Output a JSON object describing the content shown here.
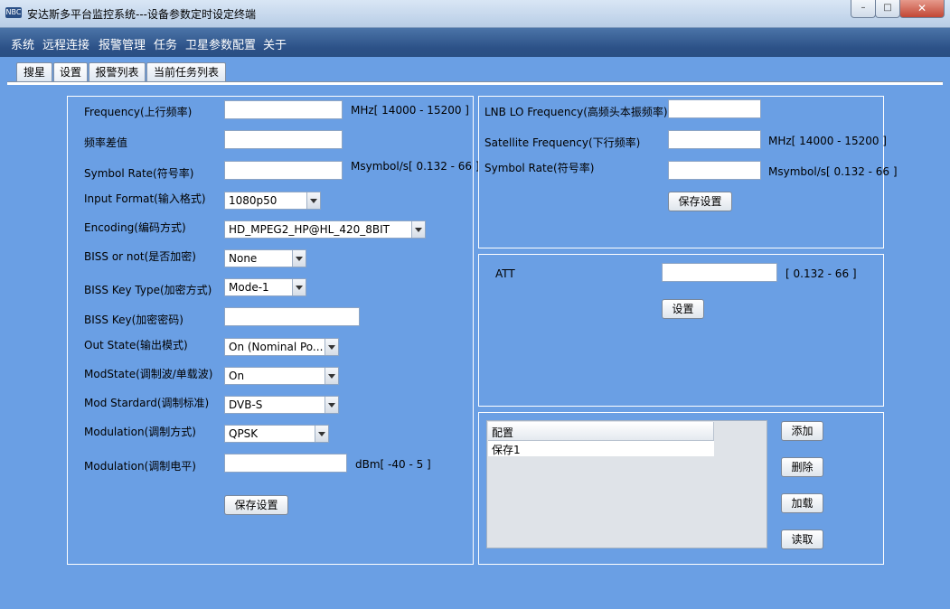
{
  "window": {
    "title": "安达斯多平台监控系统---设备参数定时设定终端",
    "app_icon": "nbc-logo-icon",
    "controls": [
      "minimize-icon",
      "maximize-icon",
      "close-icon"
    ]
  },
  "menu": [
    "系统",
    "远程连接",
    "报警管理",
    "任务",
    "卫星参数配置",
    "关于"
  ],
  "tabs": [
    "搜星",
    "设置",
    "报警列表",
    "当前任务列表"
  ],
  "active_tab": "设置",
  "left_panel": {
    "frequency_label": "Frequency(上行频率)",
    "frequency_value": "",
    "frequency_range": "MHz[ 14000 - 15200 ]",
    "freq_diff_label": "频率差值",
    "freq_diff_value": "",
    "symbol_rate_label": "Symbol Rate(符号率)",
    "symbol_rate_value": "",
    "symbol_rate_range": "Msymbol/s[ 0.132 - 66 ]",
    "input_format_label": "Input Format(输入格式)",
    "input_format_value": "1080p50",
    "encoding_label": "Encoding(编码方式)",
    "encoding_value": "HD_MPEG2_HP@HL_420_8BIT",
    "biss_label": "BISS or not(是否加密)",
    "biss_value": "None",
    "biss_key_type_label": "BISS Key Type(加密方式)",
    "biss_key_type_value": "Mode-1",
    "biss_key_label": "BISS Key(加密密码)",
    "biss_key_value": "",
    "out_state_label": "Out State(输出模式)",
    "out_state_value": "On (Nominal Po...",
    "mod_state_label": "ModState(调制波/单载波)",
    "mod_state_value": "On",
    "mod_standard_label": "Mod Stardard(调制标准)",
    "mod_standard_value": "DVB-S",
    "modulation_label": "Modulation(调制方式)",
    "modulation_value": "QPSK",
    "level_label": "Modulation(调制电平)",
    "level_value": "",
    "level_range": "dBm[ -40 - 5 ]",
    "save_button": "保存设置"
  },
  "right_top_panel": {
    "lnb_label": "LNB LO Frequency(高频头本振频率)",
    "lnb_value": "",
    "sat_freq_label": "Satellite Frequency(下行频率)",
    "sat_freq_value": "",
    "sat_freq_range": "MHz[ 14000 - 15200 ]",
    "symbol_rate_label": "Symbol Rate(符号率)",
    "symbol_rate_value": "",
    "symbol_rate_range": "Msymbol/s[ 0.132 - 66 ]",
    "save_button": "保存设置"
  },
  "att_panel": {
    "att_label": "ATT",
    "att_value": "",
    "att_range": "[ 0.132 - 66 ]",
    "set_button": "设置"
  },
  "config_panel": {
    "column_header": "配置",
    "rows": [
      "保存1"
    ],
    "buttons": {
      "add": "添加",
      "delete": "删除",
      "load": "加载",
      "read": "读取"
    }
  }
}
